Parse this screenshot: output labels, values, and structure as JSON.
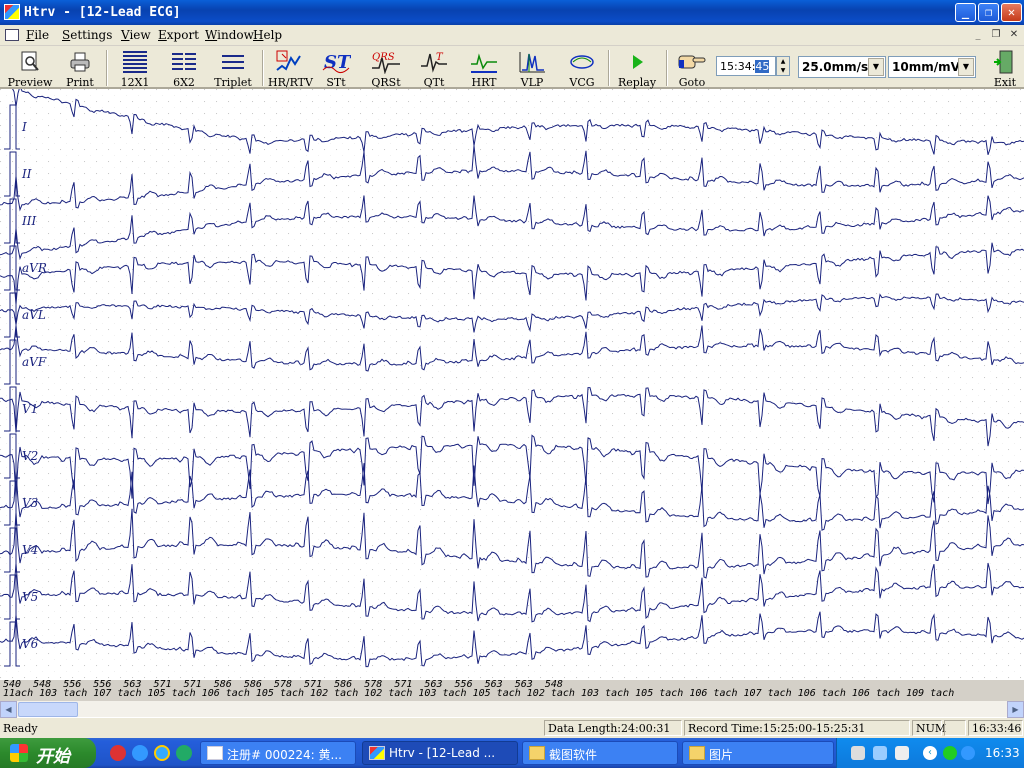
{
  "window": {
    "title": "Htrv - [12-Lead ECG]"
  },
  "menu": [
    "File",
    "Settings",
    "View",
    "Export",
    "Window",
    "Help"
  ],
  "toolbar": {
    "buttons": [
      {
        "label": "Preview",
        "icon": "preview-icon"
      },
      {
        "label": "Print",
        "icon": "print-icon"
      },
      {
        "label": "12X1",
        "icon": "layout-12x1-icon"
      },
      {
        "label": "6X2",
        "icon": "layout-6x2-icon"
      },
      {
        "label": "Triplet",
        "icon": "triplet-icon"
      },
      {
        "label": "HR/RTV",
        "icon": "hr-rtv-icon"
      },
      {
        "label": "STt",
        "icon": "st-icon"
      },
      {
        "label": "QRSt",
        "icon": "qrst-icon"
      },
      {
        "label": "QTt",
        "icon": "qt-icon"
      },
      {
        "label": "HRT",
        "icon": "hrt-icon"
      },
      {
        "label": "VLP",
        "icon": "vlp-icon"
      },
      {
        "label": "VCG",
        "icon": "vcg-icon"
      },
      {
        "label": "Replay",
        "icon": "play-icon"
      },
      {
        "label": "Goto",
        "icon": "goto-hand-icon"
      },
      {
        "label": "Exit",
        "icon": "exit-door-icon"
      }
    ],
    "time_hm": "15:34:",
    "time_s": "45",
    "speed": "25.0mm/s",
    "gain": "10mm/mV"
  },
  "leads": [
    "I",
    "II",
    "III",
    "aVR",
    "aVL",
    "aVF",
    "V1",
    "V2",
    "V3",
    "V4",
    "V5",
    "V6"
  ],
  "beat_strip": {
    "row1": "540  548  556  556  563  571  571  586  586  578  571  586  578  571  563  556  563  563  548  ",
    "row2": "11ach 103 tach 107 tach 105 tach 106 tach 105 tach 102 tach 102 tach 103 tach 105 tach 102 tach 103 tach 105 tach 106 tach 107 tach 106 tach 106 tach 109 tach"
  },
  "status": {
    "ready": "Ready",
    "data_length": "Data Length:24:00:31",
    "record_time": "Record Time:15:25:00-15:25:31",
    "num": "NUM",
    "clock": "16:33:46"
  },
  "taskbar": {
    "start": "开始",
    "tasks": [
      "注册# 000224: 黄...",
      "Htrv - [12-Lead ...",
      "截图软件",
      "图片"
    ],
    "tray_time": "16:33"
  },
  "colors": {
    "trace": "#1a237e",
    "grid": "#c8c8c8"
  }
}
